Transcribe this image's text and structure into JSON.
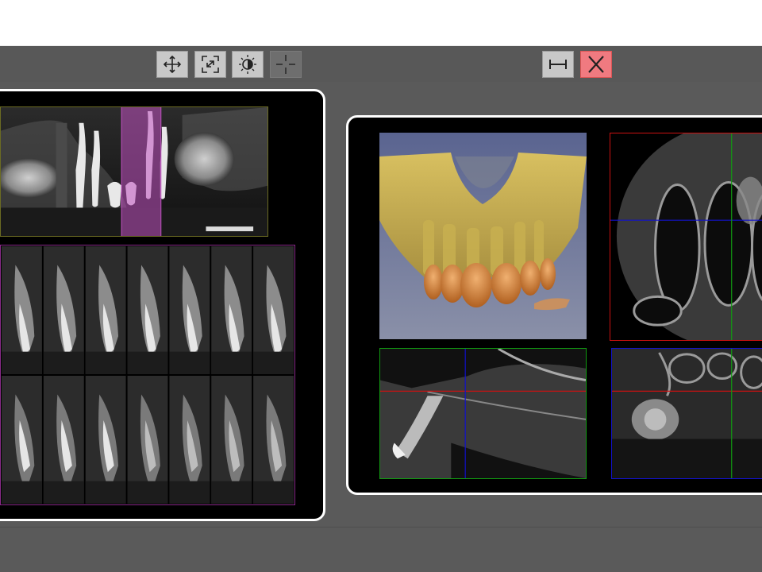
{
  "toolbar": {
    "left_tools": [
      {
        "name": "pan",
        "icon": "pan-arrows-icon",
        "active": true
      },
      {
        "name": "fit",
        "icon": "fit-screen-icon",
        "active": true
      },
      {
        "name": "contrast",
        "icon": "brightness-contrast-icon",
        "active": true
      },
      {
        "name": "crosshair",
        "icon": "crosshair-icon",
        "active": false
      }
    ],
    "right_tools": [
      {
        "name": "measure",
        "icon": "measure-ruler-icon"
      },
      {
        "name": "close",
        "icon": "close-icon"
      }
    ]
  },
  "colors": {
    "toolbar": "#585858",
    "workspace": "#5a5a5a",
    "panel_border": "#ffffff",
    "panoramic_frame": "#6b6b22",
    "cross_section_frame": "#8a2a8a",
    "axial_frame": "#cc1111",
    "sagittal_frame": "#119911",
    "coronal_frame": "#1111cc",
    "highlight": "#c050c0",
    "volume_bone": "#d4b040",
    "volume_teeth": "#e09040",
    "volume_bg": "#6a7090"
  },
  "left_panel": {
    "panoramic_view": {
      "name": "panoramic"
    },
    "cross_sections": {
      "rows": 2,
      "columns": 7
    }
  },
  "right_panel": {
    "views": [
      "volume-3d",
      "axial",
      "sagittal",
      "coronal"
    ]
  }
}
